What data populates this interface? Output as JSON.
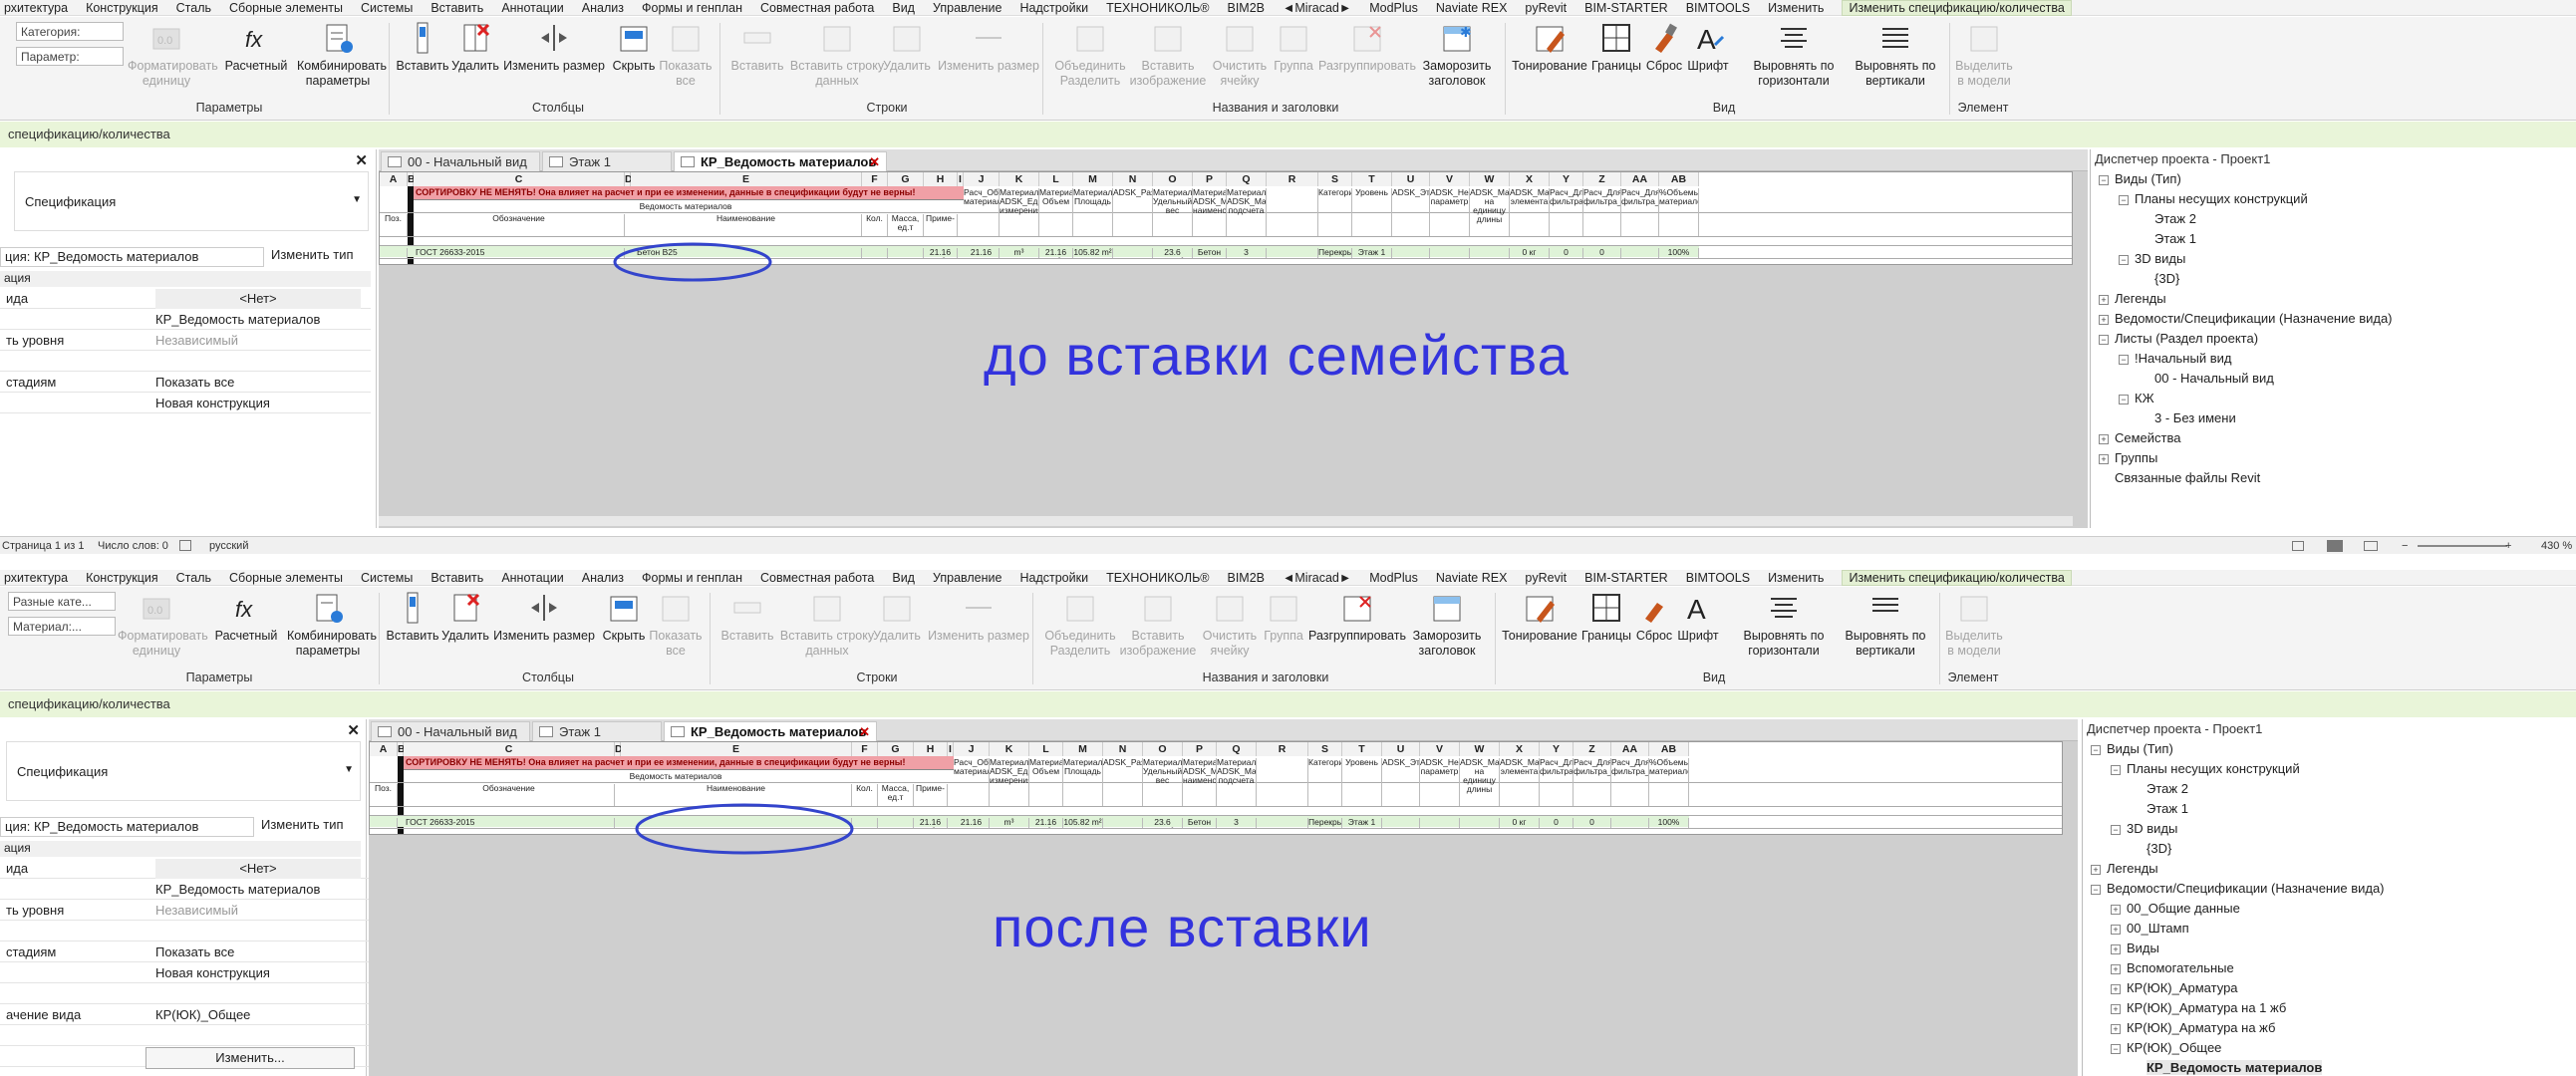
{
  "menu_top": [
    "рхитектура",
    "Конструкция",
    "Сталь",
    "Сборные элементы",
    "Системы",
    "Вставить",
    "Аннотации",
    "Анализ",
    "Формы и генплан",
    "Совместная работа",
    "Вид",
    "Управление",
    "Надстройки",
    "ТЕХНОНИКОЛЬ®",
    "BIM2B",
    "◄Miracad►",
    "ModPlus",
    "Naviate REX",
    "pyRevit",
    "BIM-STARTER",
    "BIMTOOLS",
    "Изменить",
    "Изменить спецификацию/количества"
  ],
  "menu_bottom": [
    "рхитектура",
    "Конструкция",
    "Сталь",
    "Сборные элементы",
    "Системы",
    "Вставить",
    "Аннотации",
    "Анализ",
    "Формы и генплан",
    "Совместная работа",
    "Вид",
    "Управление",
    "Надстройки",
    "ТЕХНОНИКОЛЬ®",
    "BIM2B",
    "◄Miracad►",
    "ModPlus",
    "Naviate REX",
    "pyRevit",
    "BIM-STARTER",
    "BIMTOOLS",
    "Изменить",
    "Изменить спецификацию/количества"
  ],
  "ribbon": {
    "top_select1": "Категория:",
    "top_select2": "Параметр:",
    "bot_select1": "Разные кате...",
    "bot_select2": "Материал:...",
    "btn_format": "Форматировать единицу",
    "btn_calc": "Расчетный",
    "btn_combine": "Комбинировать параметры",
    "btn_insert": "Вставить",
    "btn_delete": "Удалить",
    "btn_resize": "Изменить размер",
    "btn_hide": "Скрыть",
    "btn_show_all": "Показать все",
    "btn_row_insert": "Вставить",
    "btn_row_data": "Вставить строку данных",
    "btn_row_delete": "Удалить",
    "btn_row_resize": "Изменить размер",
    "btn_merge": "Объединить Разделить",
    "btn_insert_img": "Вставить изображение",
    "btn_clear": "Очистить ячейку",
    "btn_group": "Группа",
    "btn_ungroup": "Разгруппировать",
    "btn_freeze": "Заморозить заголовок",
    "btn_shading": "Тонирование",
    "btn_borders": "Границы",
    "btn_reset": "Сброс",
    "btn_font": "Шрифт",
    "btn_halign": "Выровнять по горизонтали",
    "btn_valign": "Выровнять по вертикали",
    "btn_highlight": "Выделить в модели",
    "grp_params": "Параметры",
    "grp_columns": "Столбцы",
    "grp_rows": "Строки",
    "grp_titles": "Названия и заголовки",
    "grp_view": "Вид",
    "grp_element": "Элемент"
  },
  "context_label": "спецификацию/количества",
  "context_label_bottom": "спецификацию/количества",
  "props_top": {
    "type": "Спецификация",
    "view_name": "ция: КР_Ведомость материалов",
    "edit_type": "Изменить тип",
    "section": "ация",
    "rows": [
      {
        "k": "ида",
        "v": "<Нет>"
      },
      {
        "k": "",
        "v": "КР_Ведомость материалов"
      },
      {
        "k": "ть уровня",
        "v": "Независимый"
      },
      {
        "k": "",
        "v": ""
      },
      {
        "k": "стадиям",
        "v": "Показать все"
      },
      {
        "k": "",
        "v": "Новая конструкция"
      }
    ]
  },
  "props_bottom": {
    "type": "Спецификация",
    "view_name": "ция: КР_Ведомость материалов",
    "edit_type": "Изменить тип",
    "section": "ация",
    "rows": [
      {
        "k": "ида",
        "v": "<Нет>"
      },
      {
        "k": "",
        "v": "КР_Ведомость материалов"
      },
      {
        "k": "ть уровня",
        "v": "Независимый"
      },
      {
        "k": "",
        "v": ""
      },
      {
        "k": "стадиям",
        "v": "Показать все"
      },
      {
        "k": "",
        "v": "Новая конструкция"
      },
      {
        "k": "",
        "v": ""
      },
      {
        "k": "ачение вида",
        "v": "КР(ЮК)_Общее"
      },
      {
        "k": "",
        "v": ""
      },
      {
        "k": "",
        "v": "Изменить..."
      }
    ]
  },
  "tabs": [
    "00 - Начальный вид",
    "Этаж 1",
    "КР_Ведомость материалов"
  ],
  "schedule": {
    "col_letters": [
      "A",
      "B",
      "C",
      "D",
      "E",
      "F",
      "G",
      "H",
      "I",
      "J",
      "K",
      "L",
      "M",
      "N",
      "O",
      "P",
      "Q",
      "R",
      "S",
      "T",
      "U",
      "V",
      "W",
      "X",
      "Y",
      "Z",
      "AA",
      "AB"
    ],
    "warning": "СОРТИРОВКУ НЕ МЕНЯТЬ! Она влияет на расчет и при ее изменении, данные в спецификации будут не верны!",
    "group_header": "Ведомость материалов",
    "headers": [
      "Поз.",
      "Обозначение",
      "Наименование",
      "Кол.",
      "Масса, ед.т",
      "Приме-",
      "Расч_Объем материала",
      "Материал: ADSK_Единица измерения",
      "Материал: Объем",
      "Материал: Площадь",
      "ADSK_Размер_Длина",
      "Материал: Удельный вес",
      "Материал: ADSK_Материал наименование",
      "Материал: ADSK_Материал подсчета",
      "",
      "Категория",
      "Уровень",
      "ADSK_Этаж",
      "ADSK_Незаданный параметр",
      "ADSK_Масса на единицу длины",
      "ADSK_Масса элемента",
      "Расч_Для фильтра_1",
      "Расч_Для фильтра_2",
      "Расч_Для фильтра_3",
      "%Объемы материалов"
    ],
    "row_top": [
      "",
      "ГОСТ 26633-2015",
      "Бетон B25",
      "",
      "",
      "21.16 m³",
      "21.16",
      "m³",
      "21.16 m³",
      "105.82 m²",
      "",
      "23.6 kH/m³",
      "Бетон B25",
      "3",
      "",
      "Перекрыти",
      "Этаж 1",
      "",
      "",
      "",
      "0 кг",
      "0",
      "0",
      "",
      "100%"
    ],
    "row_bottom": [
      "",
      "ГОСТ 26633-2015",
      "",
      "",
      "",
      "21.16 m³",
      "21.16",
      "m³",
      "21.16 m³",
      "105.82 m²",
      "",
      "23.6 kH/m³",
      "Бетон B25",
      "3",
      "",
      "Перекрыти",
      "Этаж 1",
      "",
      "",
      "",
      "0 кг",
      "0",
      "0",
      "",
      "100%"
    ]
  },
  "caption_top": "до вставки семейства",
  "caption_bottom": "после вставки",
  "browser_title": "Диспетчер проекта - Проект1",
  "tree_top": [
    {
      "t": "Виды (Тип)",
      "lvl": 0,
      "pm": "−",
      "ic": "[0]"
    },
    {
      "t": "Планы несущих конструкций",
      "lvl": 1,
      "pm": "−"
    },
    {
      "t": "Этаж 2",
      "lvl": 2
    },
    {
      "t": "Этаж 1",
      "lvl": 2
    },
    {
      "t": "3D виды",
      "lvl": 1,
      "pm": "−"
    },
    {
      "t": "{3D}",
      "lvl": 2
    },
    {
      "t": "Легенды",
      "lvl": 0,
      "pm": "+"
    },
    {
      "t": "Ведомости/Спецификации (Назначение вида)",
      "lvl": 0,
      "pm": "+"
    },
    {
      "t": "Листы (Раздел проекта)",
      "lvl": 0,
      "pm": "−"
    },
    {
      "t": "!Начальный вид",
      "lvl": 1,
      "pm": "−"
    },
    {
      "t": "00 - Начальный вид",
      "lvl": 2
    },
    {
      "t": "КЖ",
      "lvl": 1,
      "pm": "−"
    },
    {
      "t": "3 - Без имени",
      "lvl": 2
    },
    {
      "t": "Семейства",
      "lvl": 0,
      "pm": "+"
    },
    {
      "t": "Группы",
      "lvl": 0,
      "pm": "+"
    },
    {
      "t": "Связанные файлы Revit",
      "lvl": 0
    }
  ],
  "tree_bottom": [
    {
      "t": "Виды (Тип)",
      "lvl": 0,
      "pm": "−"
    },
    {
      "t": "Планы несущих конструкций",
      "lvl": 1,
      "pm": "−"
    },
    {
      "t": "Этаж 2",
      "lvl": 2
    },
    {
      "t": "Этаж 1",
      "lvl": 2
    },
    {
      "t": "3D виды",
      "lvl": 1,
      "pm": "−"
    },
    {
      "t": "{3D}",
      "lvl": 2
    },
    {
      "t": "Легенды",
      "lvl": 0,
      "pm": "+"
    },
    {
      "t": "Ведомости/Спецификации (Назначение вида)",
      "lvl": 0,
      "pm": "−"
    },
    {
      "t": "00_Общие данные",
      "lvl": 1,
      "pm": "+"
    },
    {
      "t": "00_Штамп",
      "lvl": 1,
      "pm": "+"
    },
    {
      "t": "Виды",
      "lvl": 1,
      "pm": "+"
    },
    {
      "t": "Вспомогательные",
      "lvl": 1,
      "pm": "+"
    },
    {
      "t": "КР(ЮК)_Арматура",
      "lvl": 1,
      "pm": "+"
    },
    {
      "t": "КР(ЮК)_Арматура на 1 жб",
      "lvl": 1,
      "pm": "+"
    },
    {
      "t": "КР(ЮК)_Арматура на жб",
      "lvl": 1,
      "pm": "+"
    },
    {
      "t": "КР(ЮК)_Общее",
      "lvl": 1,
      "pm": "−"
    },
    {
      "t": "КР_Ведомость материалов",
      "lvl": 2,
      "bold": true
    }
  ],
  "status": {
    "page": "Страница 1 из 1",
    "words": "Число слов: 0",
    "lang": "русский",
    "zoom": "430 %"
  },
  "colors": {
    "ribbon": "#f4f4f4",
    "context": "#e9f5d9",
    "warning": "#f0a0a6",
    "caption": "#3333dd",
    "circle": "#3344cc"
  }
}
